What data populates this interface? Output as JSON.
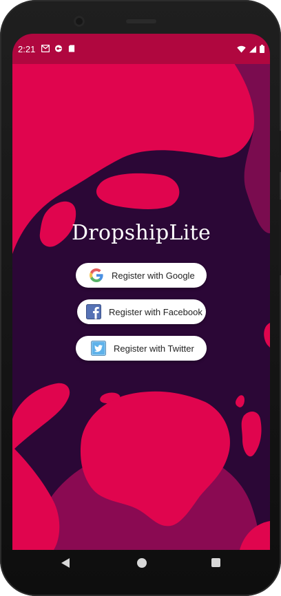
{
  "status_bar": {
    "time": "2:21",
    "left_icons": [
      "gmail-icon",
      "vpn-key-icon",
      "sd-card-icon"
    ],
    "right_icons": [
      "wifi-icon",
      "cellular-signal-icon",
      "battery-icon"
    ]
  },
  "app": {
    "title": "DropshipLite"
  },
  "buttons": {
    "google": {
      "label": "Register with Google",
      "icon": "google-icon"
    },
    "facebook": {
      "label": "Register with Facebook",
      "icon": "facebook-icon"
    },
    "twitter": {
      "label": "Register with Twitter",
      "icon": "twitter-icon"
    }
  },
  "nav_bar": {
    "back": "back-icon",
    "home": "home-icon",
    "recents": "recents-icon"
  },
  "colors": {
    "status_bar": "#b0073f",
    "primary": "#e0054e",
    "background_dark": "#2b0736",
    "blob_magenta": "#8a0a52"
  }
}
